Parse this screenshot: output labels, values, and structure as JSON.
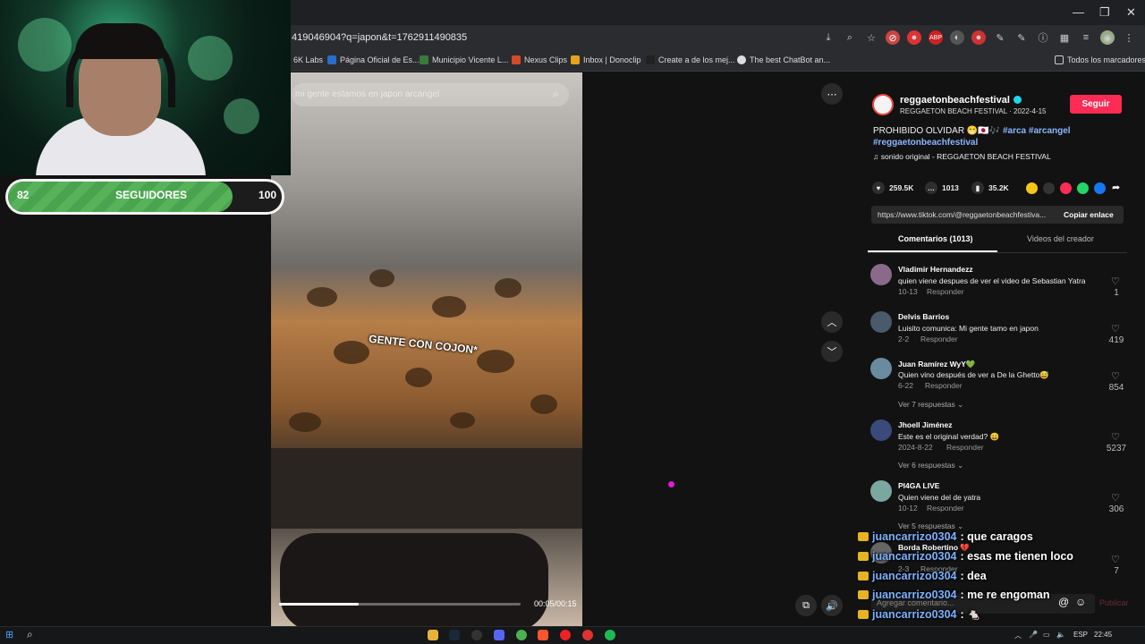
{
  "browser": {
    "url": "419046904?q=japon&t=1762911490835",
    "bookmarks": [
      {
        "label": "6K Labs",
        "color": "#6a6a6a"
      },
      {
        "label": "Página Oficial de Es...",
        "color": "#2a6cc9"
      },
      {
        "label": "Municipio Vicente L...",
        "color": "#3a7a3a"
      },
      {
        "label": "Nexus Clips",
        "color": "#d54a2a"
      },
      {
        "label": "Inbox | Donoclip",
        "color": "#e6a21a"
      },
      {
        "label": "Create a de los mej...",
        "color": "#222222"
      },
      {
        "label": "The best ChatBot an...",
        "color": "#dddddd"
      }
    ],
    "all_bookmarks": "Todos los marcadores",
    "window_controls": {
      "minimize": "—",
      "restore": "❐",
      "close": "✕"
    }
  },
  "stream_overlay": {
    "goal_current": "82",
    "goal_label": "SEGUIDORES",
    "goal_target": "100",
    "goal_progress": 0.82
  },
  "video": {
    "search_text": "mi gente estamos en japon arcangel",
    "caption": "GENTE CON COJON*",
    "timecode": "00:05/00:15",
    "progress": 0.33
  },
  "post": {
    "author": "reggaetonbeachfestival",
    "author_sub": "REGGAETON BEACH FESTIVAL · 2022-4-15",
    "follow_label": "Seguir",
    "description_text": "PROHIBIDO OLVIDAR 😁🇯🇵🎶",
    "hashtags": "#arca #arcangel",
    "hashtag_line2": "#reggaetonbeachfestival",
    "music": "sonido original - REGGAETON BEACH FESTIVAL",
    "likes": "259.5K",
    "comments": "1013",
    "saves": "35.2K",
    "link": "https://www.tiktok.com/@reggaetonbeachfestiva...",
    "copy_label": "Copiar enlace",
    "tab_comments": "Comentarios (1013)",
    "tab_creator": "Videos del creador"
  },
  "comments": [
    {
      "name": "Vladimir Hernandezz",
      "text": "quien viene despues de ver el video de Sebastian Yatra",
      "date": "10-13",
      "reply": "Responder",
      "likes": "1",
      "avatar": "#8a6a8a"
    },
    {
      "name": "Delvis Barrios",
      "text": "Luisito comunica: Mi gente tamo en japon",
      "date": "2-2",
      "reply": "Responder",
      "likes": "419",
      "avatar": "#4a5a6a"
    },
    {
      "name": "Juan Ramírez WyY💚",
      "text": "Quien vino después de ver a De la Ghetto😅",
      "date": "6-22",
      "reply": "Responder",
      "likes": "854",
      "more": "Ver 7 respuestas",
      "avatar": "#6a8aa0"
    },
    {
      "name": "Jhoell Jiménez",
      "text": "Este es el original verdad? 😄",
      "date": "2024-8-22",
      "reply": "Responder",
      "likes": "5237",
      "more": "Ver 6 respuestas",
      "avatar": "#3a4a7a"
    },
    {
      "name": "PI4GA LIVE",
      "text": "Quien viene del de yatra",
      "date": "10-12",
      "reply": "Responder",
      "likes": "306",
      "more": "Ver 5 respuestas",
      "avatar": "#7aa8a0"
    },
    {
      "name": "Borda Robertino 💔",
      "text": "",
      "date": "2-3",
      "reply": "Responder",
      "likes": "7",
      "avatar": "#666666"
    }
  ],
  "comment_input": {
    "placeholder": "Agregar comentario...",
    "post_label": "Publicar"
  },
  "chat": [
    {
      "user": "juancarrizo0304",
      "msg": ": que caragos"
    },
    {
      "user": "juancarrizo0304",
      "msg": ": esas me tienen loco"
    },
    {
      "user": "juancarrizo0304",
      "msg": ": dea"
    },
    {
      "user": "juancarrizo0304",
      "msg": ": me re engoman"
    },
    {
      "user": "juancarrizo0304",
      "msg": ": 🐁"
    },
    {
      "user": "juancarrizo0304",
      "msg": ": 🐁"
    }
  ],
  "taskbar": {
    "lang": "ESP",
    "time": "22:45"
  },
  "colors": {
    "accent": "#fe2c55",
    "chat_user": "#7ab3ff",
    "goal_fill": "#57b35a"
  }
}
